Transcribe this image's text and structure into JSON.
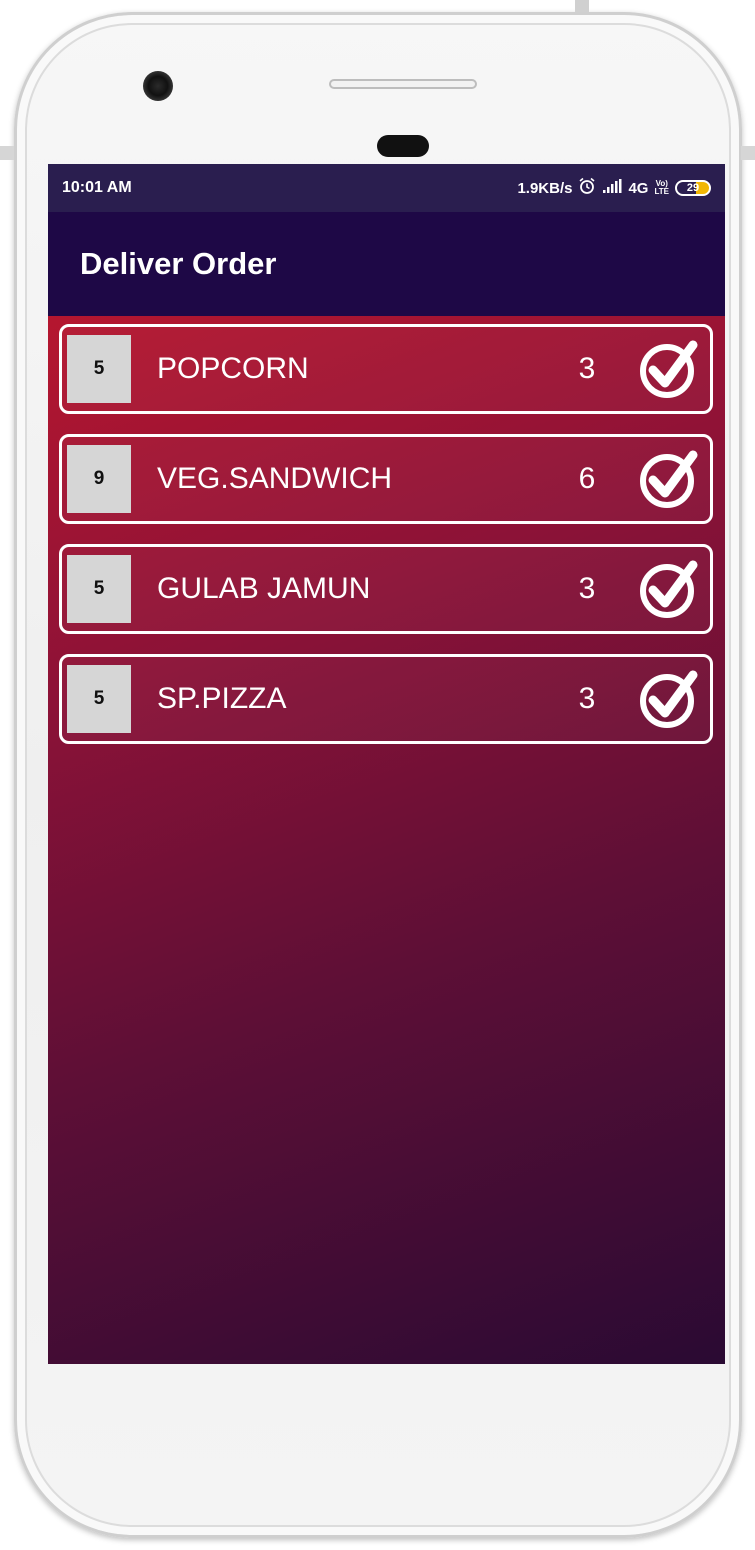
{
  "status_bar": {
    "time": "10:01 AM",
    "net_speed": "1.9KB/s",
    "network": "4G",
    "volte_top": "Vo)",
    "volte_bottom": "LTE",
    "battery": "29"
  },
  "app_bar": {
    "title": "Deliver Order"
  },
  "orders": [
    {
      "id": "5",
      "name": "POPCORN",
      "qty": "3"
    },
    {
      "id": "9",
      "name": "VEG.SANDWICH",
      "qty": "6"
    },
    {
      "id": "5",
      "name": "GULAB JAMUN",
      "qty": "3"
    },
    {
      "id": "5",
      "name": "SP.PIZZA",
      "qty": "3"
    }
  ],
  "icons": {
    "deliver": "check-circle-icon",
    "alarm": "alarm-icon",
    "signal": "signal-icon",
    "battery": "battery-icon"
  },
  "colors": {
    "status_bar": "#2a1e4f",
    "app_bar": "#1e0846",
    "gradient_start": "#b5162f",
    "gradient_end": "#2a0a33",
    "id_box": "#d6d6d6"
  }
}
